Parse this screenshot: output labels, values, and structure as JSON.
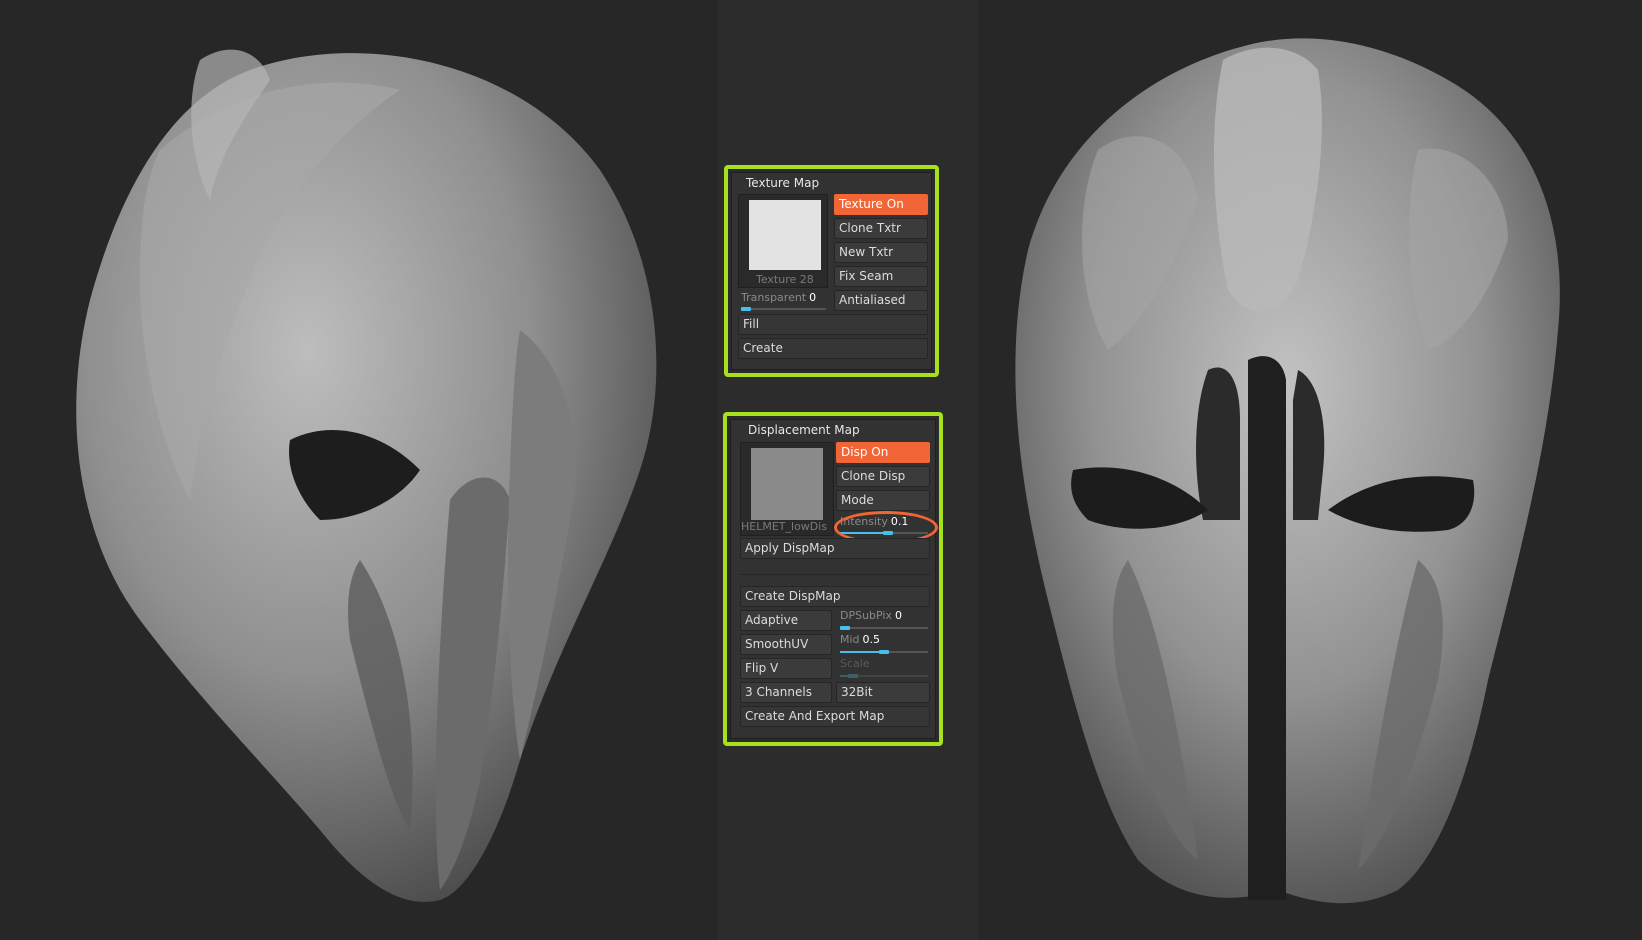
{
  "texture_map": {
    "title": "Texture Map",
    "thumb_label": "Texture 28",
    "buttons": [
      "Texture On",
      "Clone Txtr",
      "New Txtr",
      "Fix Seam",
      "Antialiased"
    ],
    "transparent": {
      "label": "Transparent",
      "value": "0",
      "fraction": 0.0
    },
    "fill_label": "Fill",
    "create_label": "Create"
  },
  "displacement_map": {
    "title": "Displacement Map",
    "thumb_label": "HELMET_lowDis",
    "buttons": [
      "Disp On",
      "Clone Disp",
      "Mode"
    ],
    "intensity": {
      "label": "Intensity",
      "value": "0.1",
      "fraction": 0.55
    },
    "apply_label": "Apply DispMap",
    "create_label": "Create DispMap",
    "adaptive_label": "Adaptive",
    "dpsubpix": {
      "label": "DPSubPix",
      "value": "0",
      "fraction": 0.0
    },
    "smoothuv_label": "SmoothUV",
    "mid": {
      "label": "Mid",
      "value": "0.5",
      "fraction": 0.5
    },
    "flipv_label": "Flip V",
    "scale": {
      "label": "Scale",
      "fraction": 0.15
    },
    "channels_label": "3 Channels",
    "bit_label": "32Bit",
    "export_label": "Create And Export Map"
  },
  "colors": {
    "active": "#f26536",
    "highlight_border": "#a7e11e",
    "slider": "#46c0e8",
    "background": "#2a2a2a"
  }
}
